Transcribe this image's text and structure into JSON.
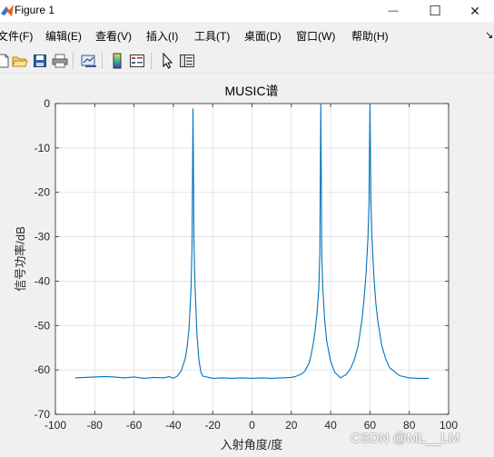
{
  "window": {
    "title": "Figure 1",
    "minimize_glyph": "—",
    "maximize_glyph": "☐",
    "close_glyph": "✕"
  },
  "menu": {
    "items": [
      "文件(F)",
      "编辑(E)",
      "查看(V)",
      "插入(I)",
      "工具(T)",
      "桌面(D)",
      "窗口(W)",
      "帮助(H)"
    ],
    "overflow_glyph": "↘"
  },
  "toolbar": {
    "icons": [
      "new-figure-icon",
      "open-file-icon",
      "save-icon",
      "print-icon",
      "link-plot-icon",
      "insert-colorbar-icon",
      "insert-legend-icon",
      "edit-plot-arrow-icon",
      "property-inspector-icon"
    ]
  },
  "chart_data": {
    "type": "line",
    "title": "MUSIC谱",
    "xlabel": "入射角度/度",
    "ylabel": "信号功率/dB",
    "xlim": [
      -100,
      100
    ],
    "ylim": [
      -70,
      0
    ],
    "xticks": [
      -100,
      -80,
      -60,
      -40,
      -20,
      0,
      20,
      40,
      60,
      80,
      100
    ],
    "yticks": [
      0,
      -10,
      -20,
      -30,
      -40,
      -50,
      -60,
      -70
    ],
    "grid": true,
    "line_color": "#0072bd",
    "peaks": [
      {
        "x": -30,
        "y": -1.2
      },
      {
        "x": 35,
        "y": 0
      },
      {
        "x": 60,
        "y": 0
      }
    ],
    "series": [
      {
        "x": [
          -90,
          -85,
          -80,
          -75,
          -70,
          -65,
          -60,
          -55,
          -50,
          -45,
          -42,
          -40,
          -38,
          -36,
          -34,
          -33,
          -32,
          -31,
          -30.5,
          -30,
          -29.5,
          -29,
          -28,
          -27,
          -26,
          -25,
          -22,
          -20,
          -15,
          -10,
          -5,
          0,
          5,
          10,
          15,
          20,
          22,
          25,
          27,
          29,
          30,
          31,
          32,
          33,
          34,
          34.5,
          35,
          35.5,
          36,
          37,
          38,
          40,
          42,
          45,
          48,
          50,
          52,
          54,
          56,
          57,
          58,
          59,
          59.5,
          60,
          60.5,
          61,
          62,
          63,
          64,
          66,
          68,
          70,
          75,
          80,
          85,
          90
        ],
        "y": [
          -61.8,
          -61.7,
          -61.6,
          -61.5,
          -61.6,
          -61.8,
          -61.6,
          -61.9,
          -61.7,
          -61.8,
          -61.5,
          -61.9,
          -61.4,
          -60.2,
          -57.5,
          -54.8,
          -50.5,
          -41.5,
          -32.0,
          -1.2,
          -31.5,
          -41.0,
          -52.0,
          -57.8,
          -60.5,
          -61.4,
          -61.7,
          -61.9,
          -61.8,
          -61.9,
          -61.8,
          -61.9,
          -61.8,
          -61.9,
          -61.8,
          -61.7,
          -61.5,
          -61.0,
          -60.2,
          -58.5,
          -56.8,
          -54.5,
          -51.5,
          -47.5,
          -41.5,
          -34.0,
          0.0,
          -34.0,
          -41.5,
          -49.0,
          -53.5,
          -58.0,
          -60.5,
          -61.8,
          -61.0,
          -59.8,
          -57.8,
          -54.5,
          -48.5,
          -44.0,
          -38.5,
          -30.0,
          -22.0,
          0.0,
          -22.0,
          -30.0,
          -39.0,
          -45.0,
          -49.0,
          -54.5,
          -57.5,
          -59.5,
          -61.3,
          -61.8,
          -61.9,
          -61.9
        ]
      }
    ]
  },
  "watermark": "CSDN @ML__LM"
}
